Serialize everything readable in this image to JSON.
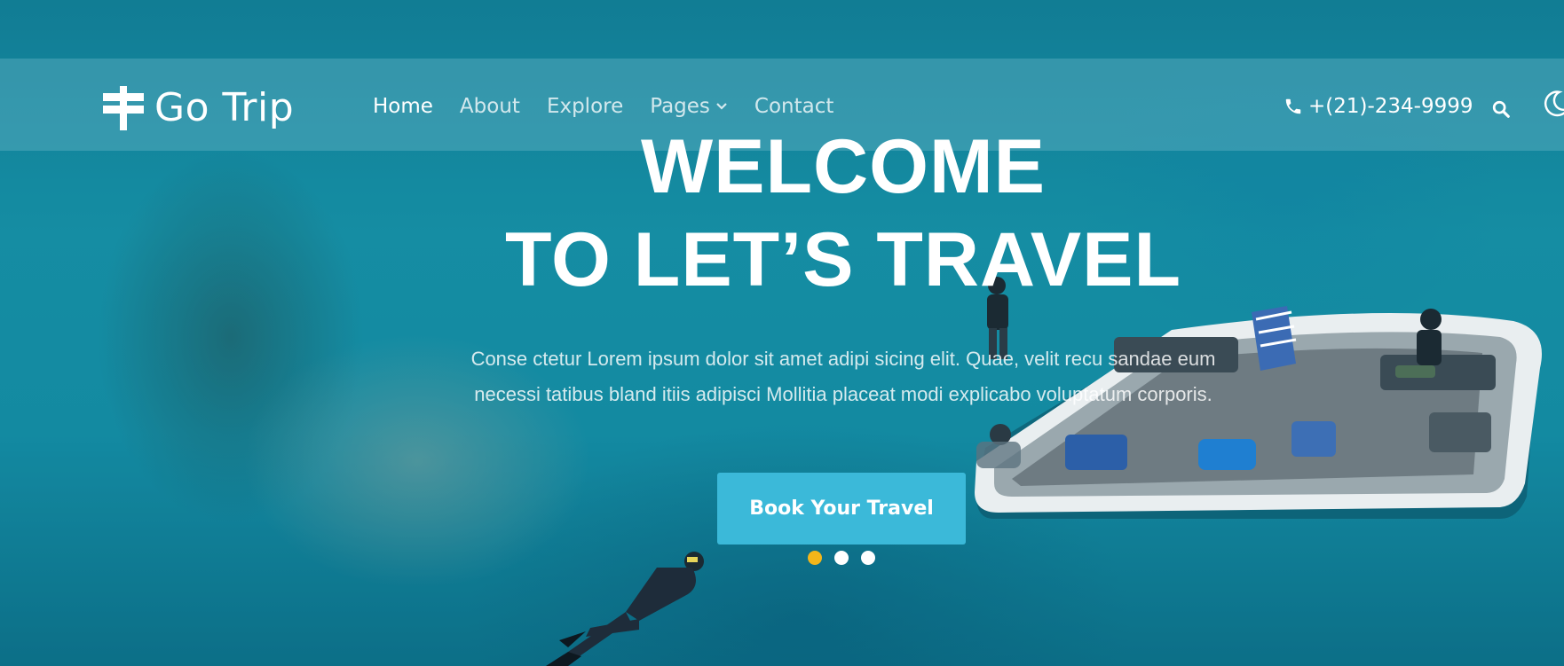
{
  "brand": {
    "name": "Go Trip",
    "icon": "signpost-icon"
  },
  "nav": {
    "items": [
      {
        "label": "Home",
        "active": true
      },
      {
        "label": "About",
        "active": false
      },
      {
        "label": "Explore",
        "active": false
      },
      {
        "label": "Pages",
        "active": false,
        "dropdown": true
      },
      {
        "label": "Contact",
        "active": false
      }
    ]
  },
  "header": {
    "phone": "+(21)-234-9999",
    "phone_icon": "phone-icon",
    "search_icon": "search-icon",
    "theme_icon": "moon-icon"
  },
  "hero": {
    "title_line1": "WELCOME",
    "title_line2": "TO LET’S TRAVEL",
    "description_line1": "Conse ctetur Lorem ipsum dolor sit amet adipi sicing elit. Quae, velit recu sandae eum",
    "description_line2": "necessi tatibus bland itiis adipisci Mollitia placeat modi explicabo voluptatum corporis.",
    "cta_label": "Book Your Travel",
    "slides": 3,
    "active_slide": 1
  },
  "colors": {
    "accent": "#3bb9d9",
    "dot_active": "#f4b61a",
    "water": "#18a0b8"
  }
}
